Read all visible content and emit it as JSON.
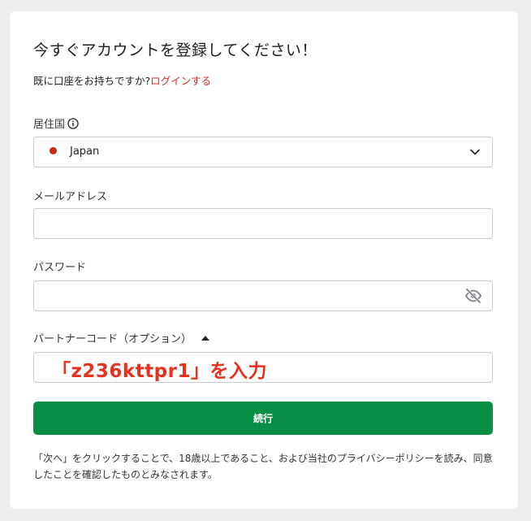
{
  "form": {
    "title": "今すぐアカウントを登録してください！",
    "subtitle_prefix": "既に口座をお持ちですか?",
    "login_link": "ログインする",
    "residence_label": "居住国",
    "residence_value": "Japan",
    "email_label": "メールアドレス",
    "email_value": "",
    "password_label": "パスワード",
    "password_value": "",
    "partner_label": "パートナーコード（オプション）",
    "partner_value": "",
    "annotation": "「z236kttpr1」を入力",
    "submit_label": "続行",
    "disclaimer": "「次へ」をクリックすることで、18歳以上であること、および当社のプライバシーポリシーを読み、同意したことを確認したものとみなされます。"
  },
  "colors": {
    "accent_green": "#0a8d44",
    "link_red": "#d3302b",
    "annotation_red": "#e5321f",
    "japan_dot": "#cc2418"
  },
  "icons": {
    "info": "info-icon",
    "chevron": "chevron-down-icon",
    "eye": "eye-slash-icon",
    "caret": "caret-up-icon"
  }
}
